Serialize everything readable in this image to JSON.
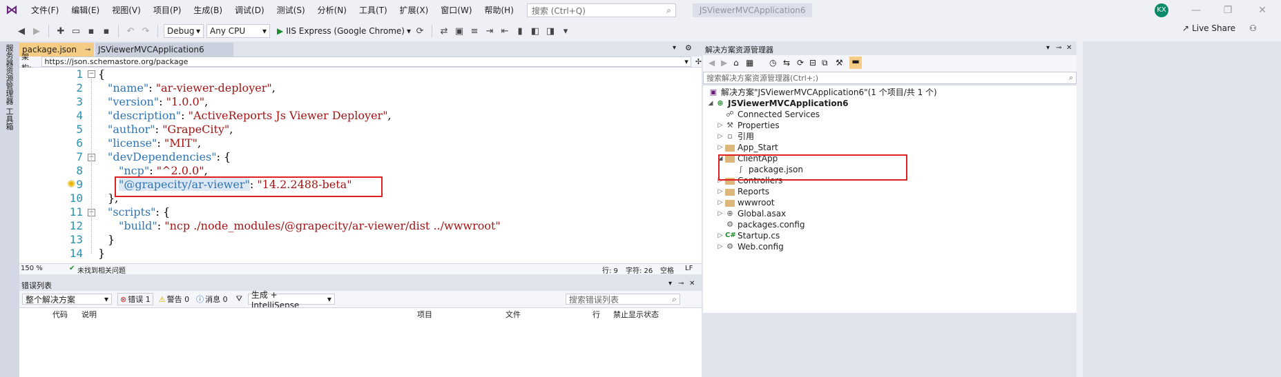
{
  "menubar": {
    "items": [
      "文件(F)",
      "编辑(E)",
      "视图(V)",
      "项目(P)",
      "生成(B)",
      "调试(D)",
      "测试(S)",
      "分析(N)",
      "工具(T)",
      "扩展(X)",
      "窗口(W)",
      "帮助(H)"
    ],
    "search_placeholder": "搜索 (Ctrl+Q)",
    "app_title": "JSViewerMVCApplication6",
    "avatar_initials": "KX"
  },
  "toolbar": {
    "config": "Debug",
    "platform": "Any CPU",
    "run_target": "IIS Express (Google Chrome)",
    "live_share": "Live Share"
  },
  "left_strip": {
    "items": [
      "服务器资源管理器",
      "工具箱"
    ]
  },
  "editor": {
    "tabs": [
      {
        "label": "package.json",
        "active": true
      },
      {
        "label": "JSViewerMVCApplication6",
        "active": false
      }
    ],
    "schema_label": "架构:",
    "schema_url": "https://json.schemastore.org/package",
    "line_numbers": [
      "1",
      "2",
      "3",
      "4",
      "5",
      "6",
      "7",
      "8",
      "9",
      "10",
      "11",
      "12",
      "13",
      "14"
    ],
    "zoom": "150 %",
    "issues": "未找到相关问题",
    "row": "行: 9",
    "col": "字符: 26",
    "mode": "空格",
    "eol": "LF"
  },
  "code": {
    "l1": "{",
    "l2_key": "\"name\"",
    "l2_val": "\"ar-viewer-deployer\"",
    "l3_key": "\"version\"",
    "l3_val": "\"1.0.0\"",
    "l4_key": "\"description\"",
    "l4_val": "\"ActiveReports Js Viewer Deployer\"",
    "l5_key": "\"author\"",
    "l5_val": "\"GrapeCity\"",
    "l6_key": "\"license\"",
    "l6_val": "\"MIT\"",
    "l7_key": "\"devDependencies\"",
    "l7_tail": ": {",
    "l8_key": "\"ncp\"",
    "l8_val": "\"^2.0.0\"",
    "l9_key": "\"@grapecity/ar-viewer\"",
    "l9_val": "\"14.2.2488-beta\"",
    "l10": "},",
    "l11_key": "\"scripts\"",
    "l11_tail": ": {",
    "l12_key": "\"build\"",
    "l12_val": "\"ncp ./node_modules/@grapecity/ar-viewer/dist ../wwwroot\"",
    "l13": "}",
    "l14": "}"
  },
  "error_list": {
    "title": "错误列表",
    "scope": "整个解决方案",
    "errors": "错误 1",
    "warnings": "警告 0",
    "messages": "消息 0",
    "build_filter": "生成 + IntelliSense",
    "search_placeholder": "搜索错误列表",
    "columns": [
      "代码",
      "说明",
      "项目",
      "文件",
      "行",
      "禁止显示状态"
    ]
  },
  "solution_explorer": {
    "title": "解决方案资源管理器",
    "search_placeholder": "搜索解决方案资源管理器(Ctrl+;)",
    "solution": "解决方案\"JSViewerMVCApplication6\"(1 个项目/共 1 个)",
    "project": "JSViewerMVCApplication6",
    "nodes": [
      "Connected Services",
      "Properties",
      "引用",
      "App_Start",
      "ClientApp",
      "package.json",
      "Controllers",
      "Reports",
      "wwwroot",
      "Global.asax",
      "packages.config",
      "Startup.cs",
      "Web.config"
    ]
  },
  "colors": {
    "accent": "#007acc",
    "tab_active": "#f5cc84",
    "highlight_box": "#e02020",
    "json_key": "#2e75b6",
    "json_string": "#a31515"
  }
}
